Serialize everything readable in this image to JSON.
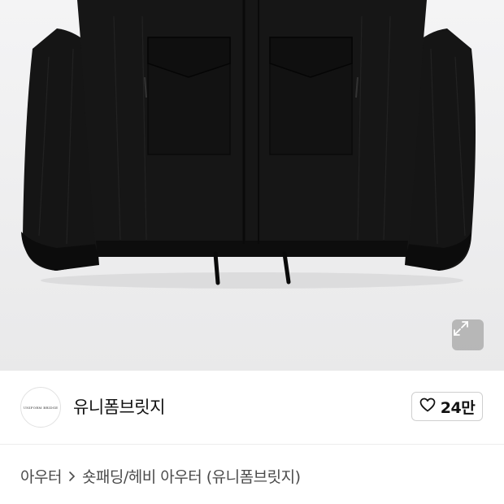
{
  "product": {
    "image_alt": "black quilted jacket",
    "expand_icon": "expand-arrows-icon"
  },
  "seller": {
    "logo_text": "UNIFORM BRIDGE",
    "name": "유니폼브릿지"
  },
  "like": {
    "icon": "heart-outline-icon",
    "count": "24만"
  },
  "breadcrumb": {
    "items": [
      {
        "label": "아우터"
      },
      {
        "label": "숏패딩/헤비 아우터 (유니폼브릿지)"
      }
    ],
    "separator_icon": "chevron-right-icon"
  },
  "colors": {
    "hero_bg": "#efeff0",
    "jacket": "#141414",
    "text_primary": "#111111",
    "text_secondary": "#4a4a4a"
  }
}
